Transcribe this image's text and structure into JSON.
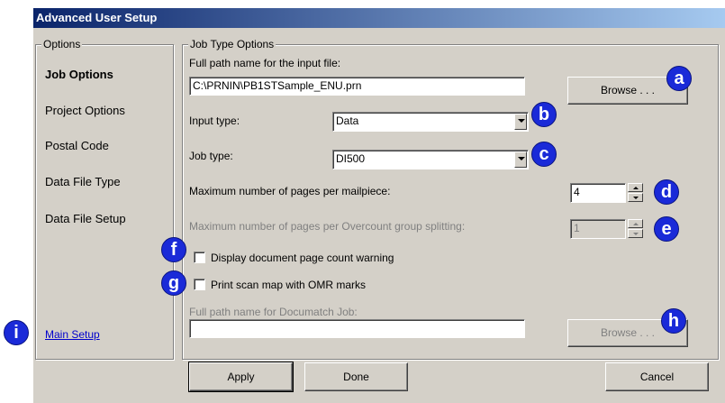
{
  "window": {
    "title": "Advanced User Setup"
  },
  "nav": {
    "group_label": "Options",
    "items": [
      "Job Options",
      "Project Options",
      "Postal Code",
      "Data File Type",
      "Data File Setup"
    ],
    "main_setup_link": "Main Setup"
  },
  "job": {
    "group_label": "Job Type Options",
    "input_file_label": "Full path name for the input file:",
    "input_file_value": "C:\\PRNIN\\PB1STSample_ENU.prn",
    "browse_label": "Browse . . .",
    "input_type_label": "Input type:",
    "input_type_value": "Data",
    "job_type_label": "Job type:",
    "job_type_value": "DI500",
    "max_pages_label": "Maximum number of pages per mailpiece:",
    "max_pages_value": "4",
    "overcount_label": "Maximum number of pages per Overcount group splitting:",
    "overcount_value": "1",
    "display_warning_label": "Display document page count warning",
    "print_scan_label": "Print scan map with OMR marks",
    "documatch_label": "Full path name for Documatch Job:",
    "documatch_value": "",
    "browse2_label": "Browse . . ."
  },
  "footer": {
    "apply": "Apply",
    "done": "Done",
    "cancel": "Cancel"
  },
  "callouts": [
    "a",
    "b",
    "c",
    "d",
    "e",
    "f",
    "g",
    "h",
    "i"
  ],
  "colors": {
    "titlebar_start": "#0a246a",
    "titlebar_end": "#a6caf0",
    "callout": "#1a2ad8",
    "dialog_bg": "#d4d0c8"
  }
}
